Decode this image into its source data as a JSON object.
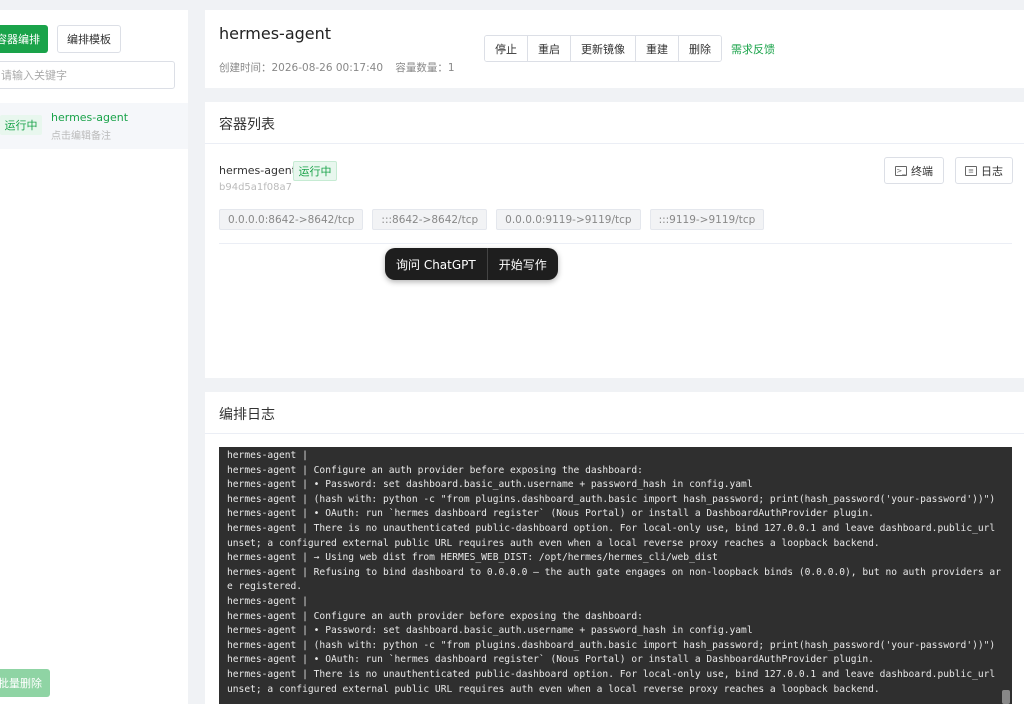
{
  "sidebar": {
    "compose_button": "容器编排",
    "template_button": "编排模板",
    "search_placeholder": "请输入关键字",
    "item": {
      "status": "运行中",
      "name": "hermes-agent",
      "note": "点击编辑备注"
    },
    "batch_delete": "批量删除"
  },
  "header": {
    "title": "hermes-agent",
    "created": "创建时间：2026-08-26 00:17:40",
    "count": "容量数量：1",
    "actions": [
      "停止",
      "重启",
      "更新镜像",
      "重建",
      "删除"
    ],
    "feedback": "需求反馈"
  },
  "containers": {
    "section_title": "容器列表",
    "name": "hermes-agent",
    "status": "运行中",
    "id": "b94d5a1f08a7",
    "terminal_button": "终端",
    "log_button": "日志",
    "ports": [
      "0.0.0.0:8642->8642/tcp",
      ":::8642->8642/tcp",
      "0.0.0.0:9119->9119/tcp",
      ":::9119->9119/tcp"
    ]
  },
  "popup": {
    "ask": "询问 ChatGPT",
    "write": "开始写作"
  },
  "logs": {
    "section_title": "编排日志",
    "lines": [
      "hermes-agent |",
      "hermes-agent | Configure an auth provider before exposing the dashboard:",
      "hermes-agent | • Password: set dashboard.basic_auth.username + password_hash in config.yaml",
      "hermes-agent | (hash with: python -c \"from plugins.dashboard_auth.basic import hash_password; print(hash_password('your-password'))\")",
      "hermes-agent | • OAuth: run `hermes dashboard register` (Nous Portal) or install a DashboardAuthProvider plugin.",
      "hermes-agent | There is no unauthenticated public-dashboard option. For local-only use, bind 127.0.0.1 and leave dashboard.public_url unset; a configured external public URL requires auth even when a local reverse proxy reaches a loopback backend.",
      "hermes-agent | → Using web dist from HERMES_WEB_DIST: /opt/hermes/hermes_cli/web_dist",
      "hermes-agent | Refusing to bind dashboard to 0.0.0.0 — the auth gate engages on non-loopback binds (0.0.0.0), but no auth providers are registered.",
      "hermes-agent |",
      "hermes-agent | Configure an auth provider before exposing the dashboard:",
      "hermes-agent | • Password: set dashboard.basic_auth.username + password_hash in config.yaml",
      "hermes-agent | (hash with: python -c \"from plugins.dashboard_auth.basic import hash_password; print(hash_password('your-password'))\")",
      "hermes-agent | • OAuth: run `hermes dashboard register` (Nous Portal) or install a DashboardAuthProvider plugin.",
      "hermes-agent | There is no unauthenticated public-dashboard option. For local-only use, bind 127.0.0.1 and leave dashboard.public_url unset; a configured external public URL requires auth even when a local reverse proxy reaches a loopback backend."
    ]
  }
}
